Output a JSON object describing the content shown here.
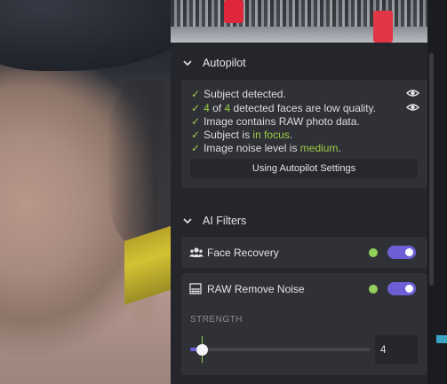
{
  "autopilot": {
    "title": "Autopilot",
    "lines": [
      {
        "check": "✓",
        "text": "Subject detected."
      },
      {
        "check": "✓",
        "pre": "4",
        "mid": " of ",
        "hl": "4",
        "text": " detected faces are low quality."
      },
      {
        "check": "✓",
        "text": "Image contains RAW photo data."
      },
      {
        "check": "✓",
        "pre": "Subject is ",
        "hl": "in focus",
        "post": "."
      },
      {
        "check": "✓",
        "pre": "Image noise level is ",
        "hl": "medium",
        "post": "."
      }
    ],
    "button_label": "Using Autopilot Settings"
  },
  "ai_filters": {
    "title": "AI Filters",
    "items": [
      {
        "label": "Face Recovery",
        "icon": "people-icon",
        "enabled": true
      },
      {
        "label": "RAW Remove Noise",
        "icon": "raw-grid-icon",
        "enabled": true
      }
    ],
    "strength_label": "STRENGTH",
    "strength_value": "4",
    "strength_fraction": 0.06
  },
  "colors": {
    "accent": "#6c5fd6",
    "status_green": "#92cf5a",
    "highlight": "#9ccb45"
  }
}
